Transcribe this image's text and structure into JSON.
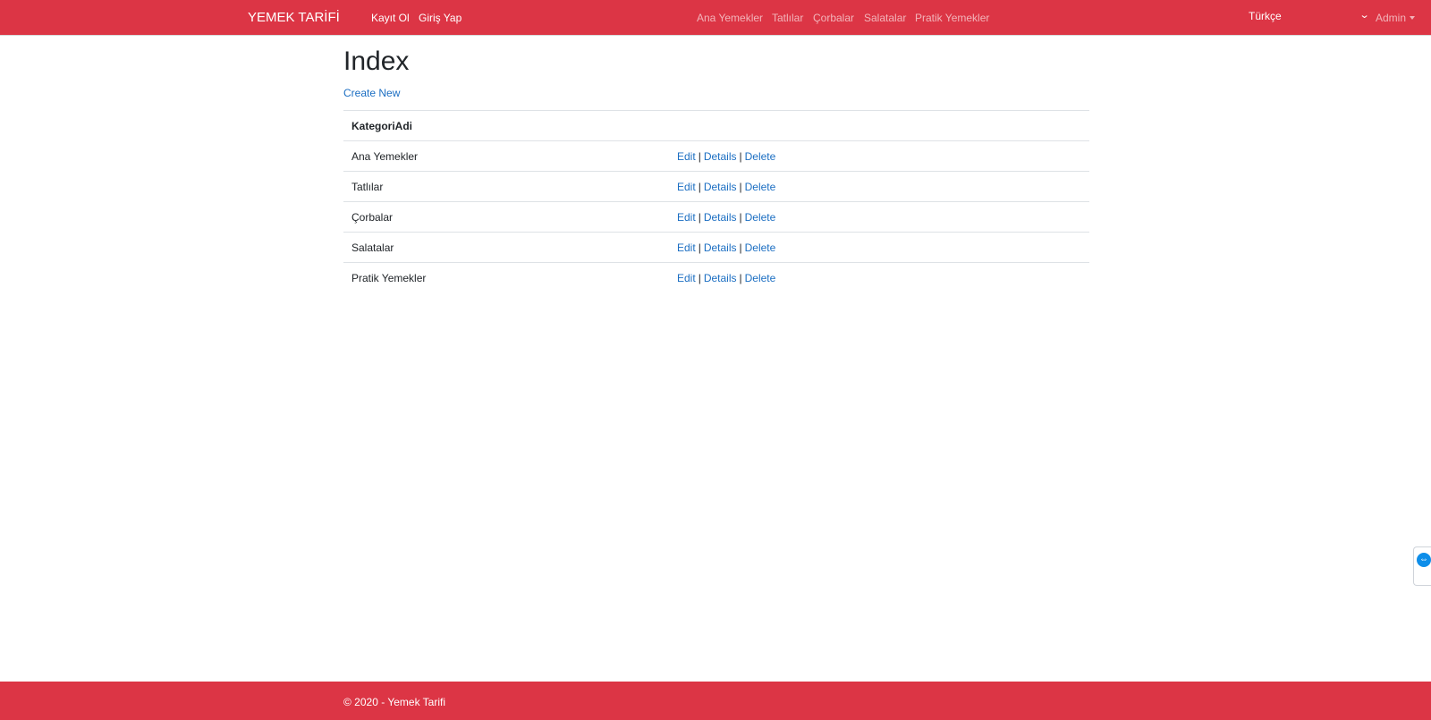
{
  "navbar": {
    "brand": "YEMEK TARİFİ",
    "auth_links": [
      "Kayıt Ol",
      "Giriş Yap"
    ],
    "categories": [
      "Ana Yemekler",
      "Tatlılar",
      "Çorbalar",
      "Salatalar",
      "Pratik Yemekler"
    ],
    "language": "Türkçe",
    "user_menu": "Admin"
  },
  "main": {
    "title": "Index",
    "create_link": "Create New",
    "table": {
      "header": "KategoriAdi",
      "rows": [
        {
          "name": "Ana Yemekler"
        },
        {
          "name": "Tatlılar"
        },
        {
          "name": "Çorbalar"
        },
        {
          "name": "Salatalar"
        },
        {
          "name": "Pratik Yemekler"
        }
      ],
      "actions": {
        "edit": "Edit",
        "details": "Details",
        "delete": "Delete",
        "separator": "|"
      }
    }
  },
  "footer": {
    "text": "© 2020 - Yemek Tarifi"
  },
  "colors": {
    "navbar_bg": "#dc3545",
    "link": "#1b6ec2"
  },
  "icons": {
    "language_dropdown": "chevron-down-icon",
    "user_menu": "caret-down-icon",
    "side_widget": "remote-support-icon"
  }
}
